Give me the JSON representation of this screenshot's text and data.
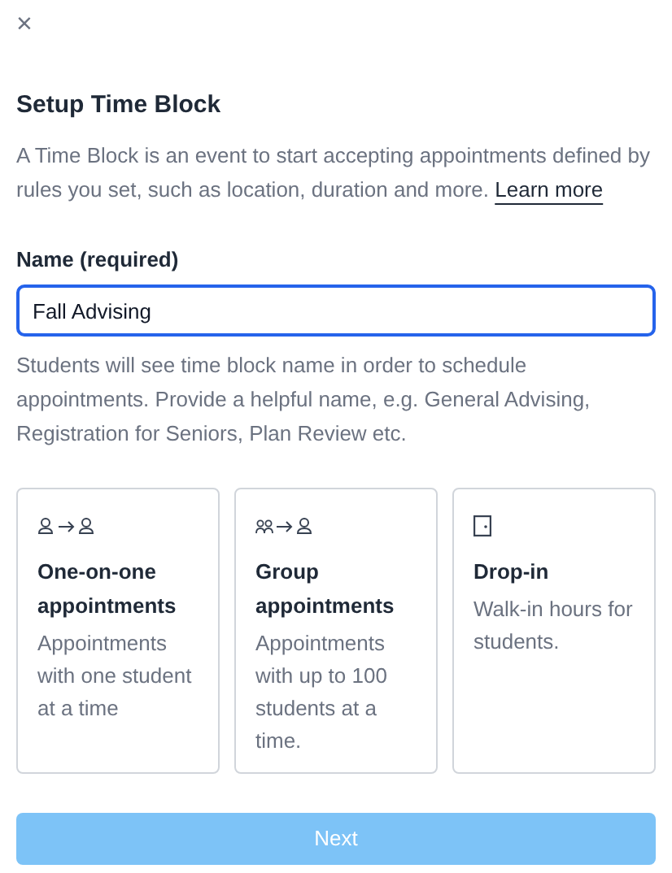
{
  "close_label": "×",
  "title": "Setup Time Block",
  "description": "A Time Block is an event to start accepting appointments defined by rules you set, such as location, duration and more.",
  "learn_more": "Learn more",
  "name_field": {
    "label": "Name (required)",
    "value": "Fall Advising",
    "focused": true
  },
  "helper_text": "Students will see time block name in order to schedule appointments. Provide a helpful name, e.g. General Advising, Registration for Seniors, Plan Review etc.",
  "cards": [
    {
      "kind": "one_to_one",
      "title": "One-on-one appointments",
      "description": "Appointments with one student at a time",
      "selected": false
    },
    {
      "kind": "group",
      "title": "Group appointments",
      "description": "Appointments with up to 100 students at a time.",
      "selected": false
    },
    {
      "kind": "drop_in",
      "title": "Drop-in",
      "description": "Walk-in hours for students.",
      "selected": false
    }
  ],
  "next_button": {
    "label": "Next",
    "disabled": true
  }
}
